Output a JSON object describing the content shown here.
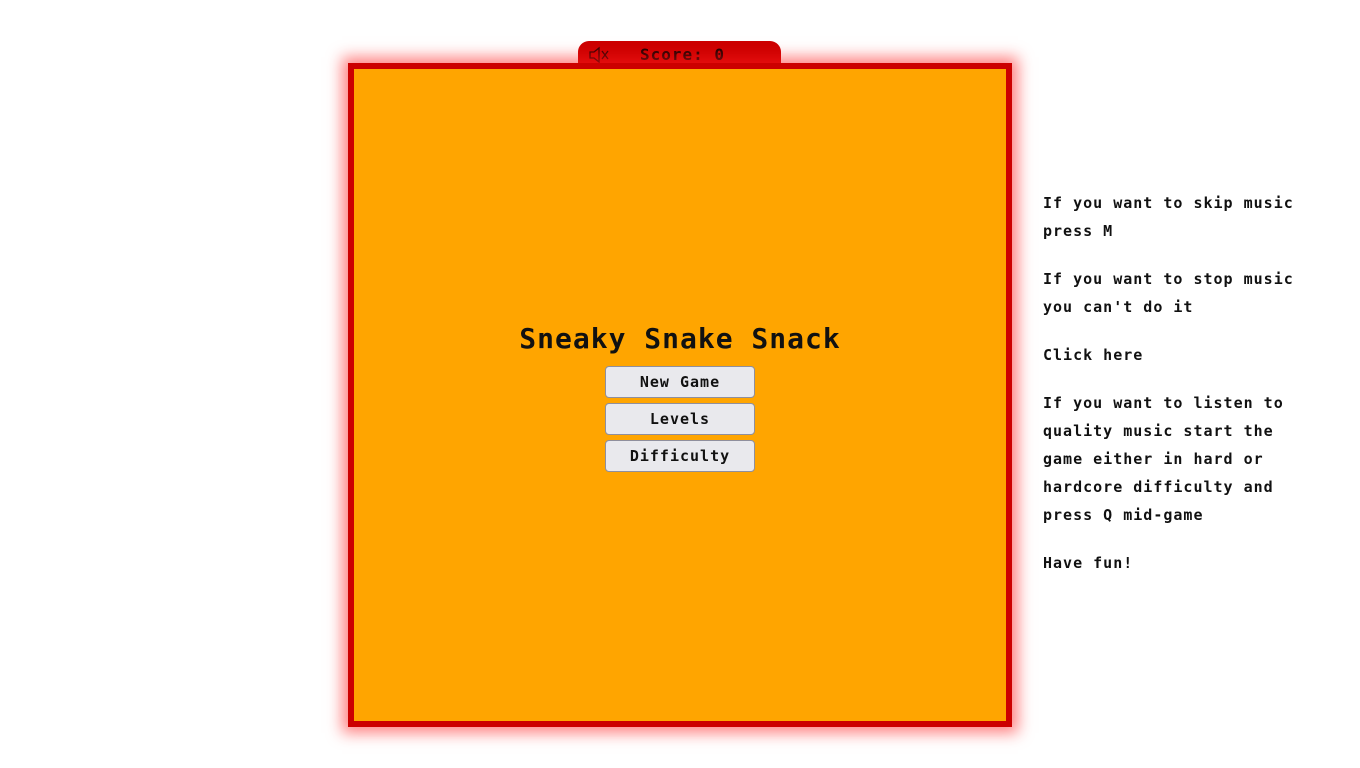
{
  "header": {
    "score_label": "Score: 0",
    "mute_icon": "speaker-muted-icon"
  },
  "menu": {
    "title": "Sneaky Snake Snack",
    "buttons": {
      "new_game": "New Game",
      "levels": "Levels",
      "difficulty": "Difficulty"
    }
  },
  "instructions": {
    "skip_music": "If you want to skip music press M",
    "stop_music": "If you want to stop music you can't do it",
    "click_here": "Click here",
    "quality_music": "If you want to listen to quality music start the game either in hard or hardcore difficulty and press Q mid-game",
    "have_fun": "Have fun!"
  },
  "colors": {
    "board_background": "#ffa500",
    "board_border": "#cc0000",
    "glow": "#ff1e1e",
    "button_background": "#e9e9ed"
  }
}
